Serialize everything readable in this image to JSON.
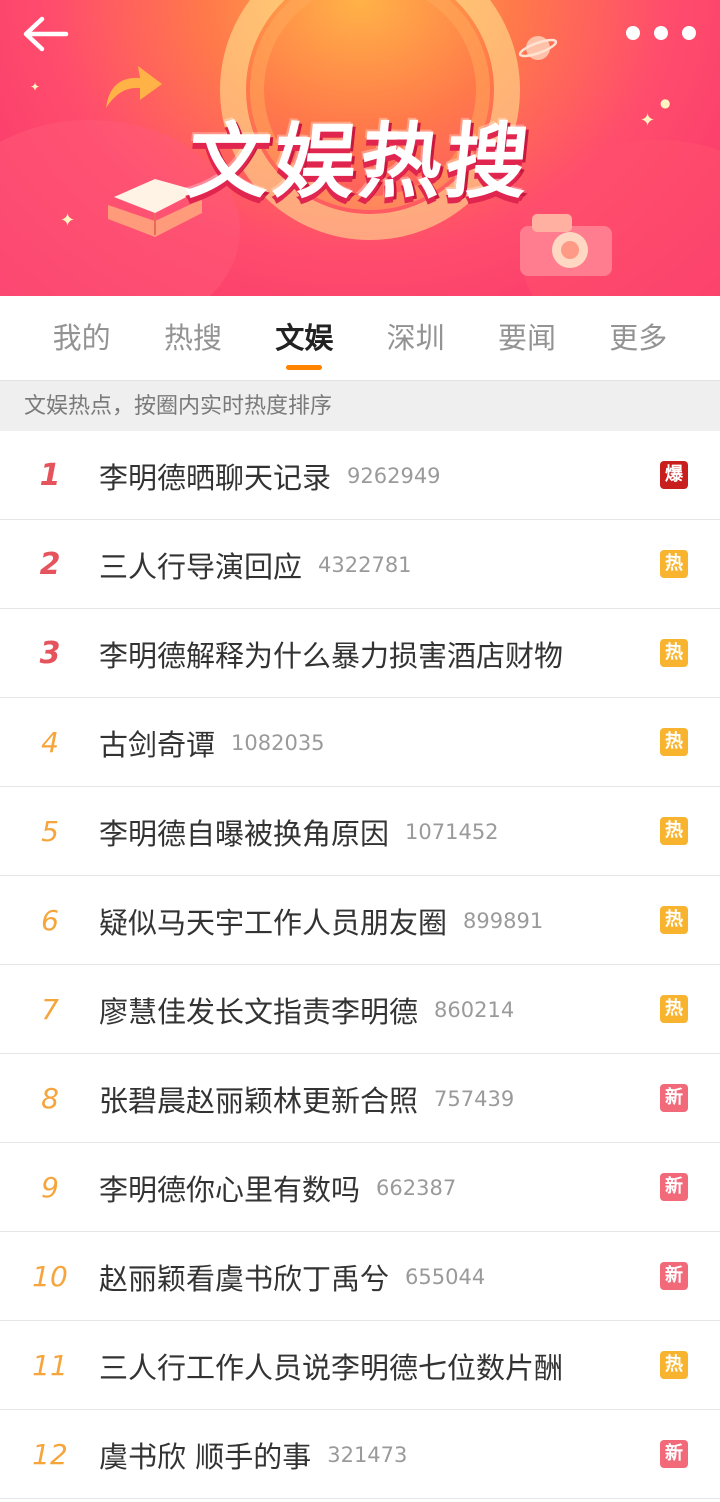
{
  "banner": {
    "title": "文娱热搜"
  },
  "tabs": [
    "我的",
    "热搜",
    "文娱",
    "深圳",
    "要闻",
    "更多"
  ],
  "active_tab_index": 2,
  "hint": "文娱热点，按圈内实时热度排序",
  "colors": {
    "accent": "#ff8200",
    "badge_explode": "#c81e1e",
    "badge_hot": "#f8b42e",
    "badge_new": "#f2697a"
  },
  "items": [
    {
      "rank": "1",
      "topic": "李明德晒聊天记录",
      "count": "9262949",
      "badge": "爆",
      "badge_type": "bao"
    },
    {
      "rank": "2",
      "topic": "三人行导演回应",
      "count": "4322781",
      "badge": "热",
      "badge_type": "re"
    },
    {
      "rank": "3",
      "topic": "李明德解释为什么暴力损害酒店财物",
      "count": "",
      "badge": "热",
      "badge_type": "re"
    },
    {
      "rank": "4",
      "topic": "古剑奇谭",
      "count": "1082035",
      "badge": "热",
      "badge_type": "re"
    },
    {
      "rank": "5",
      "topic": "李明德自曝被换角原因",
      "count": "1071452",
      "badge": "热",
      "badge_type": "re"
    },
    {
      "rank": "6",
      "topic": "疑似马天宇工作人员朋友圈",
      "count": "899891",
      "badge": "热",
      "badge_type": "re"
    },
    {
      "rank": "7",
      "topic": "廖慧佳发长文指责李明德",
      "count": "860214",
      "badge": "热",
      "badge_type": "re"
    },
    {
      "rank": "8",
      "topic": "张碧晨赵丽颖林更新合照",
      "count": "757439",
      "badge": "新",
      "badge_type": "xin"
    },
    {
      "rank": "9",
      "topic": "李明德你心里有数吗",
      "count": "662387",
      "badge": "新",
      "badge_type": "xin"
    },
    {
      "rank": "10",
      "topic": "赵丽颖看虞书欣丁禹兮",
      "count": "655044",
      "badge": "新",
      "badge_type": "xin"
    },
    {
      "rank": "11",
      "topic": "三人行工作人员说李明德七位数片酬",
      "count": "",
      "badge": "热",
      "badge_type": "re"
    },
    {
      "rank": "12",
      "topic": "虞书欣 顺手的事",
      "count": "321473",
      "badge": "新",
      "badge_type": "xin"
    }
  ]
}
